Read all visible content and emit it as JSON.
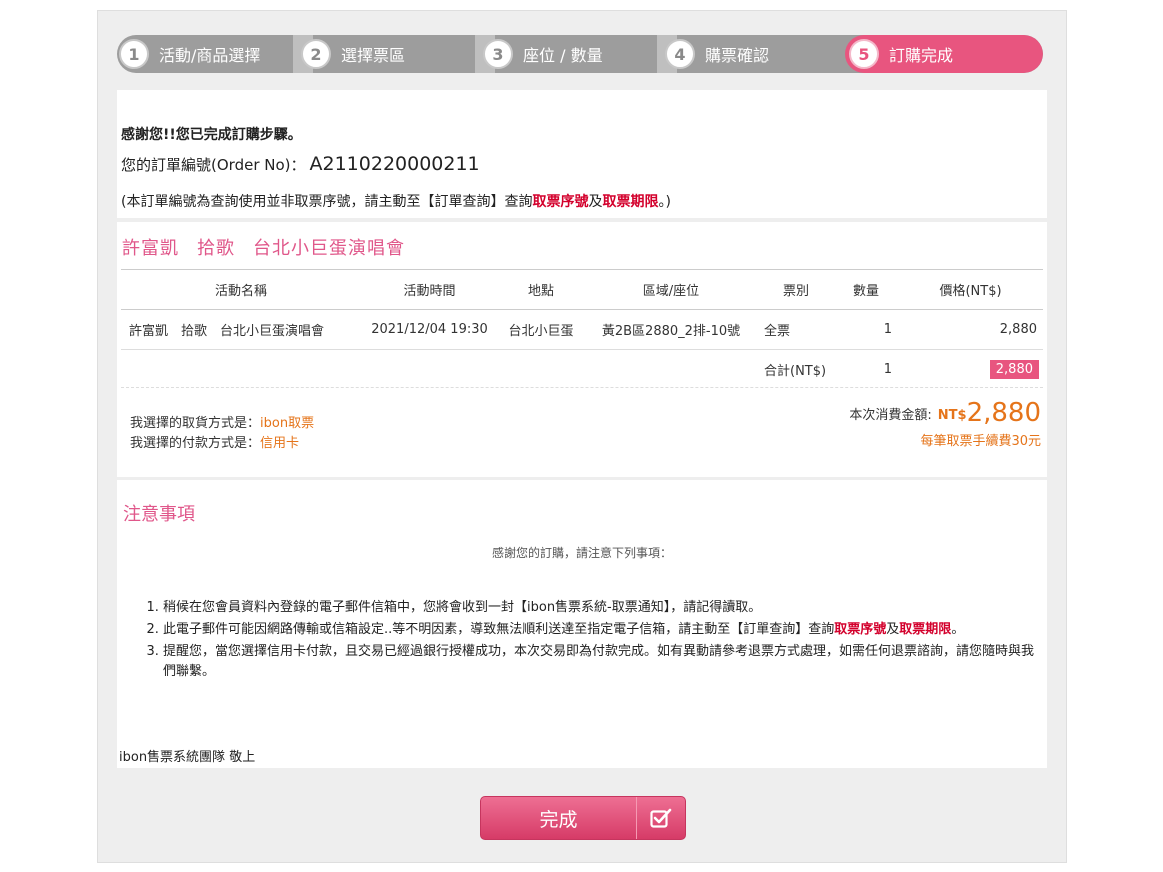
{
  "steps": [
    {
      "num": "1",
      "label": "活動/商品選擇"
    },
    {
      "num": "2",
      "label": "選擇票區"
    },
    {
      "num": "3",
      "label": "座位 / 數量"
    },
    {
      "num": "4",
      "label": "購票確認"
    },
    {
      "num": "5",
      "label": "訂購完成"
    }
  ],
  "confirm": {
    "thanks": "感謝您!!您已完成訂購步驟。",
    "order_label": "您的訂單編號(Order No)：",
    "order_no": "A2110220000211",
    "note_prefix": "(本訂單編號為查詢使用並非取票序號，請主動至【訂單查詢】查詢",
    "note_red1": "取票序號",
    "note_mid": "及",
    "note_red2": "取票期限",
    "note_suffix": "。)"
  },
  "event": {
    "title_parts": [
      "許富凱",
      "拾歌",
      "台北小巨蛋演唱會"
    ],
    "columns": [
      "活動名稱",
      "活動時間",
      "地點",
      "區域/座位",
      "票別",
      "數量",
      "價格(NT$)"
    ],
    "row": {
      "name": "許富凱　拾歌　台北小巨蛋演唱會",
      "time": "2021/12/04 19:30",
      "venue": "台北小巨蛋",
      "seat": "黃2B區2880_2排-10號",
      "type": "全票",
      "qty": "1",
      "price": "2,880"
    },
    "subtotal": {
      "label": "合計(NT$)",
      "qty": "1",
      "price": "2,880"
    },
    "pickup_label": "我選擇的取貨方式是：",
    "pickup_value": "ibon取票",
    "payment_label": "我選擇的付款方式是：",
    "payment_value": "信用卡",
    "total_label": "本次消費金額:",
    "total_currency": "NT$",
    "total_amount": "2,880",
    "fee_note": "每筆取票手續費30元"
  },
  "notice": {
    "title": "注意事項",
    "subtitle": "感謝您的訂購，請注意下列事項：",
    "item1": "稍候在您會員資料內登錄的電子郵件信箱中，您將會收到一封【ibon售票系統-取票通知】，請記得讀取。",
    "item2_prefix": "此電子郵件可能因網路傳輸或信箱設定..等不明因素，導致無法順利送達至指定電子信箱，請主動至【訂單查詢】查詢",
    "item2_red1": "取票序號",
    "item2_mid": "及",
    "item2_red2": "取票期限",
    "item2_suffix": "。",
    "item3": "提醒您，當您選擇信用卡付款，且交易已經過銀行授權成功，本次交易即為付款完成。如有異動請參考退票方式處理，如需任何退票諮詢，請您隨時與我們聯繫。",
    "signature": "ibon售票系統團隊 敬上"
  },
  "button": {
    "done_label": "完成",
    "icon": "checkbox-icon"
  },
  "colors": {
    "accent": "#e8557f",
    "orange": "#e5741a",
    "red": "#d3002c"
  }
}
